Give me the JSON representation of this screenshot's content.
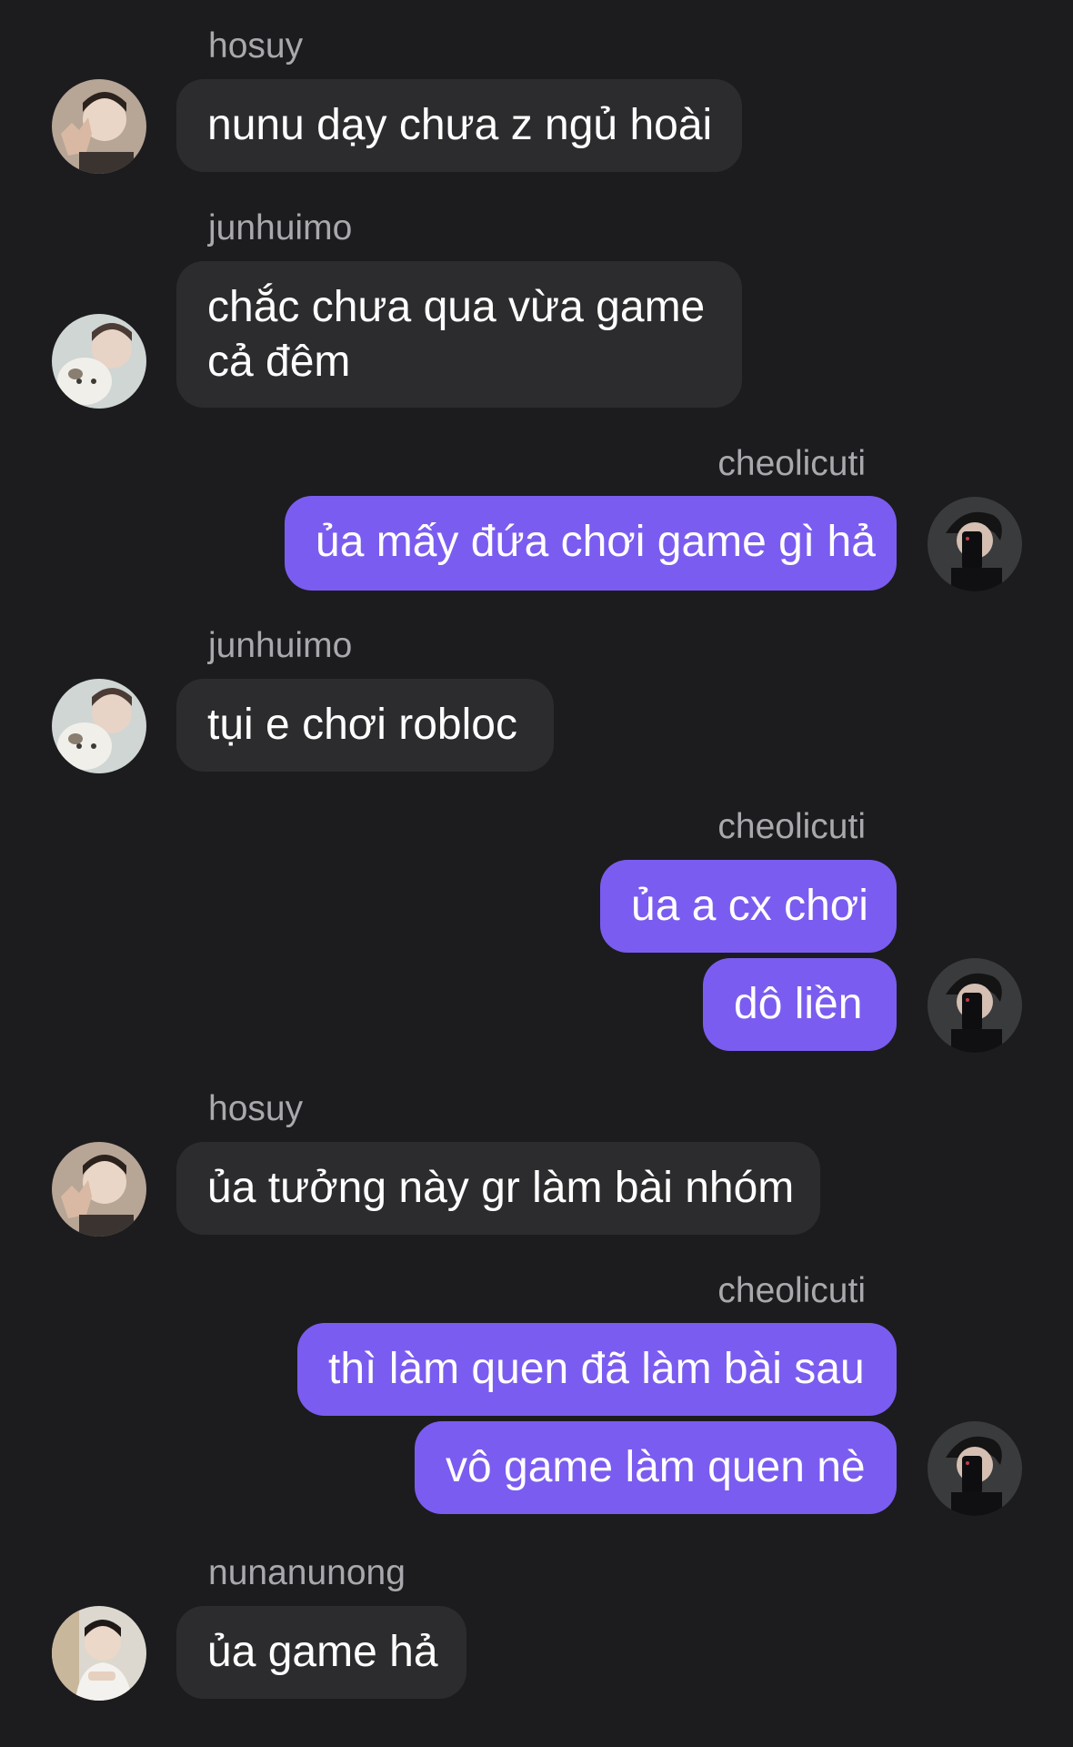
{
  "messages": [
    {
      "sender": "hosuy",
      "text": "nunu dạy chưa z ngủ hoài"
    },
    {
      "sender": "junhuimo",
      "text": "chắc chưa qua vừa game cả đêm"
    },
    {
      "sender": "cheolicuti",
      "text": "ủa mấy đứa chơi game gì hả"
    },
    {
      "sender": "junhuimo",
      "text": "tụi e chơi robloc"
    },
    {
      "sender": "cheolicuti",
      "text": "ủa a cx chơi"
    },
    {
      "text": "dô liền"
    },
    {
      "sender": "hosuy",
      "text": "ủa tưởng này gr làm bài nhóm"
    },
    {
      "sender": "cheolicuti",
      "text": "thì làm quen đã làm bài sau"
    },
    {
      "text": "vô game làm quen nè"
    },
    {
      "sender": "nunanunong",
      "text": "ủa game hả"
    }
  ],
  "colors": {
    "background": "#1c1c1e",
    "incoming_bubble": "#2c2c2e",
    "outgoing_bubble": "#7b5cf0",
    "sender_name": "#a8a8ad"
  }
}
